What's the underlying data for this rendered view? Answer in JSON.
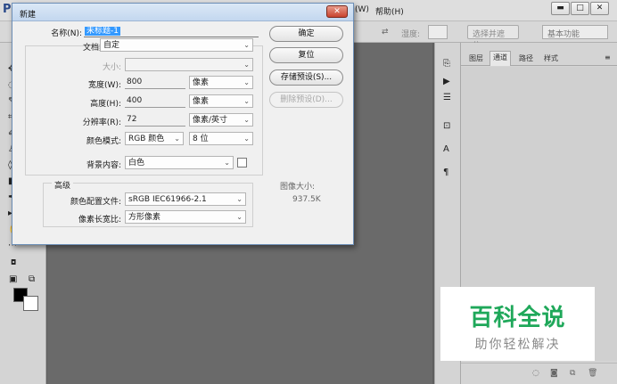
{
  "app": {
    "logo": "P",
    "menu": [
      {
        "label": "(W)"
      },
      {
        "label": "帮助(H)"
      }
    ],
    "window_controls": {
      "minimize": "▬",
      "maximize": "□",
      "close": "✕"
    }
  },
  "options_bar": {
    "opacity_label": "湿度:",
    "select_subject": "选择并遮住...",
    "workspace": "基本功能"
  },
  "panel": {
    "tabs": [
      {
        "label": "图层"
      },
      {
        "label": "通道"
      },
      {
        "label": "路径"
      },
      {
        "label": "样式"
      }
    ],
    "active_tab": 1
  },
  "dialog": {
    "title": "新建",
    "close_label": "✕",
    "name_label": "名称(N):",
    "name_value": "未标题-1",
    "doc_type_label": "文档类型:",
    "doc_type_value": "自定",
    "size_label": "大小:",
    "size_value": "",
    "width_label": "宽度(W):",
    "width_value": "800",
    "width_unit": "像素",
    "height_label": "高度(H):",
    "height_value": "400",
    "height_unit": "像素",
    "resolution_label": "分辨率(R):",
    "resolution_value": "72",
    "resolution_unit": "像素/英寸",
    "color_mode_label": "颜色模式:",
    "color_mode_value": "RGB 颜色",
    "bit_depth_value": "8 位",
    "background_label": "背景内容:",
    "background_value": "白色",
    "advanced_label": "高级",
    "color_profile_label": "颜色配置文件:",
    "color_profile_value": "sRGB IEC61966-2.1",
    "pixel_aspect_label": "像素长宽比:",
    "pixel_aspect_value": "方形像素",
    "image_size_label": "图像大小:",
    "image_size_value": "937.5K",
    "buttons": {
      "ok": "确定",
      "reset": "复位",
      "save_preset": "存储预设(S)...",
      "delete_preset": "删除预设(D)..."
    }
  },
  "watermark": {
    "title": "百科全说",
    "subtitle": "助你轻松解决"
  }
}
